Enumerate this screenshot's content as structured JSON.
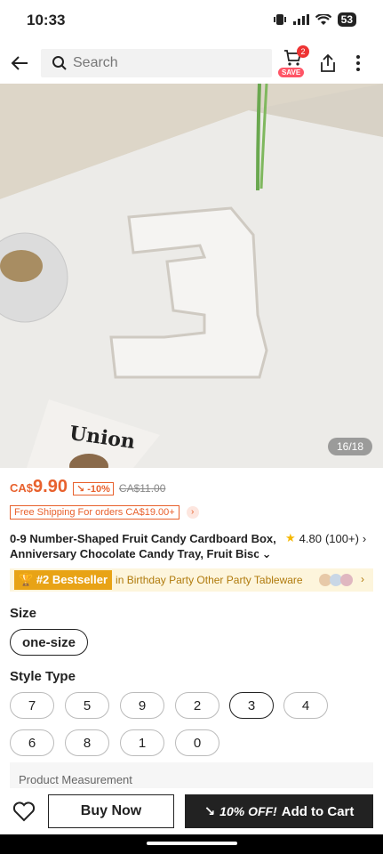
{
  "status": {
    "time": "10:33",
    "battery": "53"
  },
  "search": {
    "placeholder": "Search"
  },
  "cart": {
    "count": "2",
    "save_label": "SAVE"
  },
  "image": {
    "counter": "16/18",
    "union_text": "Union"
  },
  "price": {
    "currency": "CA$",
    "amount": "9.90",
    "discount": "-10%",
    "original": "CA$11.00"
  },
  "shipping": {
    "text": "Free Shipping For orders CA$19.00+"
  },
  "product": {
    "title_line1": "0-9 Number-Shaped Fruit Candy Cardboard Box,",
    "title_line2": "Anniversary Chocolate Candy Tray, Fruit Biscuit",
    "rating": "4.80",
    "reviews": "(100+)"
  },
  "bestseller": {
    "tag": "#2 Bestseller",
    "category": "in Birthday Party Other Party Tableware"
  },
  "size": {
    "label": "Size",
    "option": "one-size"
  },
  "style": {
    "label": "Style Type",
    "row1": [
      "7",
      "5",
      "9",
      "2",
      "3",
      "4"
    ],
    "row2": [
      "6",
      "8",
      "1",
      "0"
    ],
    "selected": "3"
  },
  "measure": {
    "label": "Product Measurement"
  },
  "actions": {
    "buy_now": "Buy Now",
    "off": "10% OFF!",
    "add_to_cart": "Add to Cart"
  },
  "colors": {
    "accent": "#e8612d",
    "dark": "#222222",
    "gold": "#e8a316"
  }
}
